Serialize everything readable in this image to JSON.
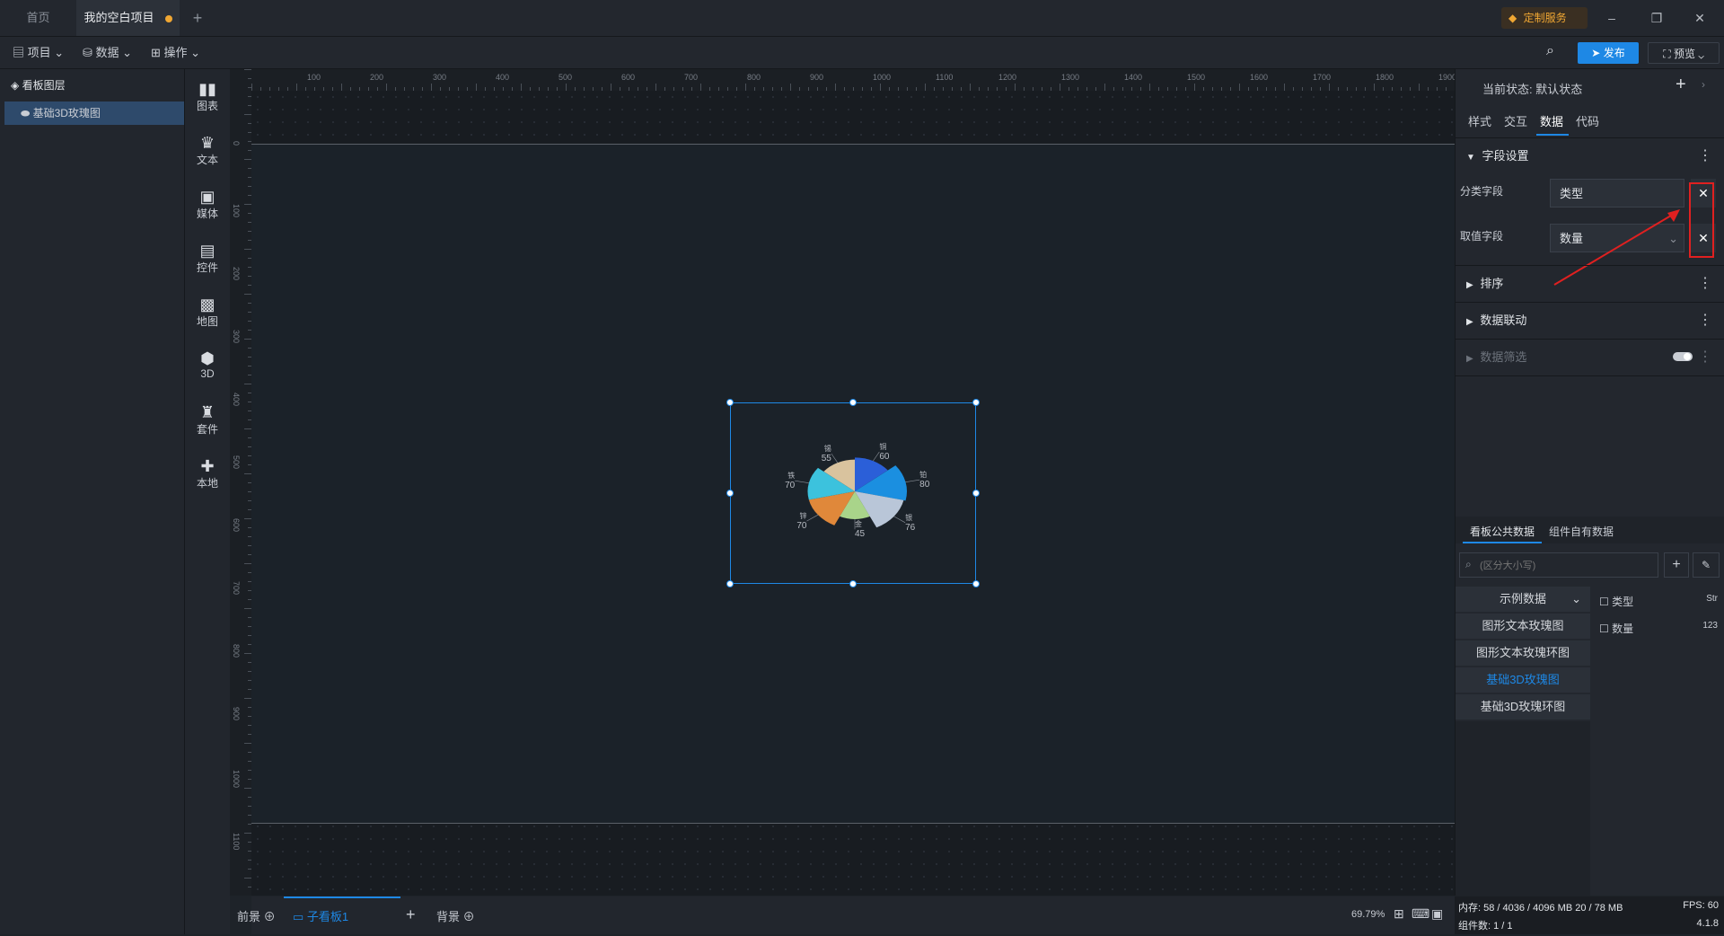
{
  "tabs": [
    {
      "label": "首页"
    },
    {
      "label": "我的空白项目"
    }
  ],
  "titlebar": {
    "custom_service": "定制服务"
  },
  "toolbar": {
    "menus": [
      {
        "label": "项目"
      },
      {
        "label": "数据"
      },
      {
        "label": "操作"
      }
    ],
    "publish": "发布",
    "preview": "预览"
  },
  "layers": {
    "title": "看板图层",
    "items": [
      {
        "label": "基础3D玫瑰图"
      }
    ]
  },
  "components": [
    {
      "label": "图表",
      "icon": "chart-icon"
    },
    {
      "label": "文本",
      "icon": "text-icon"
    },
    {
      "label": "媒体",
      "icon": "media-icon"
    },
    {
      "label": "控件",
      "icon": "control-icon"
    },
    {
      "label": "地图",
      "icon": "map-icon"
    },
    {
      "label": "3D",
      "icon": "cube-icon"
    },
    {
      "label": "套件",
      "icon": "kit-icon"
    },
    {
      "label": "本地",
      "icon": "puzzle-icon"
    }
  ],
  "ruler": {
    "top_ticks": [
      "100",
      "200",
      "300",
      "400",
      "500",
      "600",
      "700",
      "800",
      "900",
      "1000",
      "1100",
      "1200",
      "1300",
      "1400",
      "1500",
      "1600",
      "1700",
      "1800",
      "1900"
    ],
    "left_ticks": [
      "0",
      "100",
      "200",
      "300",
      "400",
      "500",
      "600",
      "700",
      "800",
      "900",
      "1000",
      "1100"
    ]
  },
  "chart_data": {
    "type": "pie",
    "variant": "3d-rose",
    "title": "",
    "slices": [
      {
        "label": "铜",
        "value": 60,
        "color": "#2b5fd8"
      },
      {
        "label": "铂",
        "value": 80,
        "color": "#1b8fe0"
      },
      {
        "label": "银",
        "value": 76,
        "color": "#b9c6d8"
      },
      {
        "label": "金",
        "value": 45,
        "color": "#a9d48a"
      },
      {
        "label": "锌",
        "value": 70,
        "color": "#e0883a"
      },
      {
        "label": "铁",
        "value": 70,
        "color": "#3cc2dd"
      },
      {
        "label": "锡",
        "value": 55,
        "color": "#d9c39e"
      }
    ]
  },
  "right": {
    "state_label": "当前状态:",
    "state_value": "默认状态",
    "tabs": [
      {
        "label": "样式"
      },
      {
        "label": "交互"
      },
      {
        "label": "数据"
      },
      {
        "label": "代码"
      }
    ],
    "field_settings": "字段设置",
    "category_label": "分类字段",
    "category_value": "类型",
    "value_label": "取值字段",
    "value_value": "数量",
    "sort": "排序",
    "linkage": "数据联动",
    "filter": "数据筛选",
    "data_tabs": [
      {
        "label": "看板公共数据"
      },
      {
        "label": "组件自有数据"
      }
    ],
    "search_placeholder": "(区分大小写)",
    "datasets_header": "示例数据",
    "datasets": [
      {
        "label": "图形文本玫瑰图"
      },
      {
        "label": "图形文本玫瑰环图"
      },
      {
        "label": "基础3D玫瑰图"
      },
      {
        "label": "基础3D玫瑰环图"
      }
    ],
    "fields": [
      {
        "name": "类型",
        "type": "Str"
      },
      {
        "name": "数量",
        "type": "123"
      }
    ]
  },
  "bottom": {
    "front": "前景",
    "subboard": "子看板1",
    "background": "背景",
    "zoom": "69.79%"
  },
  "status": {
    "memory": "内存: 58 / 4036 / 4096 MB  20 / 78 MB",
    "fps": "FPS: 60",
    "components": "组件数: 1 / 1",
    "version": "4.1.8"
  },
  "colors": {
    "accent": "#1e88e5",
    "annotation": "#e02020",
    "dirty_dot": "#f0a733"
  }
}
